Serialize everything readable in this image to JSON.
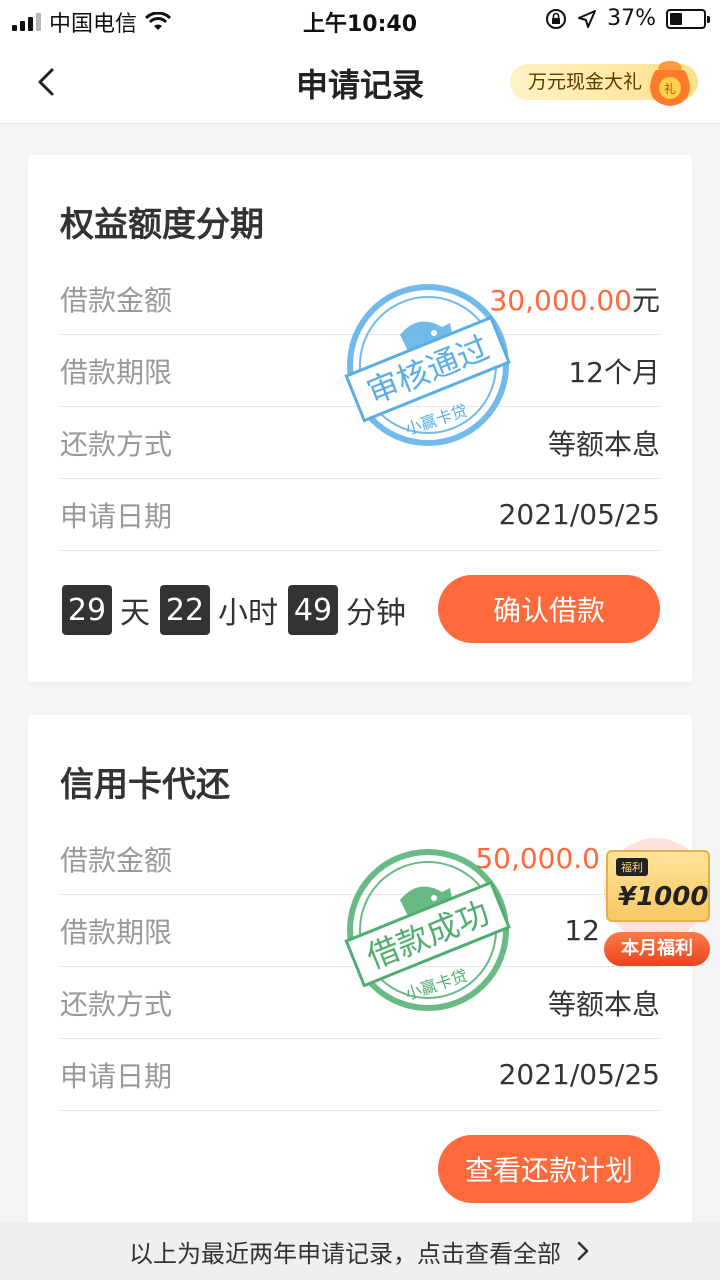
{
  "status_bar": {
    "carrier": "中国电信",
    "time": "上午10:40",
    "battery_percent": "37%",
    "battery_level": 0.37
  },
  "nav": {
    "title": "申请记录",
    "promo_label": "万元现金大礼",
    "promo_bag_text": "礼"
  },
  "cards": [
    {
      "title": "权益额度分期",
      "rows": [
        {
          "label": "借款金额",
          "amount": "30,000.00",
          "unit": "元"
        },
        {
          "label": "借款期限",
          "value": "12个月"
        },
        {
          "label": "还款方式",
          "value": "等额本息"
        },
        {
          "label": "申请日期",
          "value": "2021/05/25"
        }
      ],
      "stamp": {
        "main": "审核通过",
        "sub": "小赢卡贷",
        "color": "#5aaee6"
      },
      "countdown": {
        "days": "29",
        "days_unit": "天",
        "hours": "22",
        "hours_unit": "小时",
        "minutes": "49",
        "minutes_unit": "分钟"
      },
      "action_label": "确认借款"
    },
    {
      "title": "信用卡代还",
      "rows": [
        {
          "label": "借款金额",
          "amount": "50,000.0"
        },
        {
          "label": "借款期限",
          "value": "12"
        },
        {
          "label": "还款方式",
          "value": "等额本息"
        },
        {
          "label": "申请日期",
          "value": "2021/05/25"
        }
      ],
      "stamp": {
        "main": "借款成功",
        "sub": "小赢卡贷",
        "color": "#4fae6f"
      },
      "action_label": "查看还款计划"
    }
  ],
  "welfare": {
    "tag": "福利",
    "amount": "¥1000",
    "ribbon": "本月福利"
  },
  "footer": {
    "text": "以上为最近两年申请记录，点击查看全部"
  },
  "colors": {
    "accent": "#ff6a3d",
    "stamp_blue": "#5aaee6",
    "stamp_green": "#4fae6f"
  }
}
